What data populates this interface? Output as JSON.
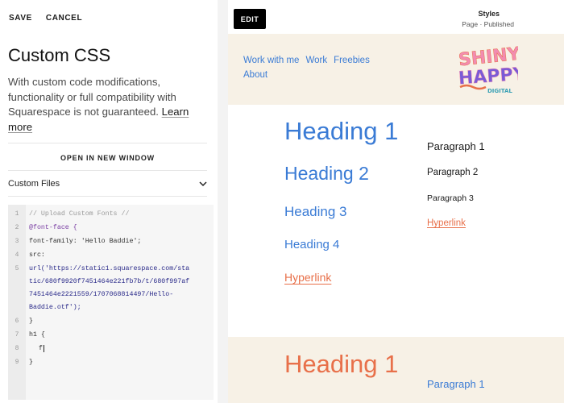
{
  "toolbar": {
    "save": "SAVE",
    "cancel": "CANCEL"
  },
  "panel": {
    "title": "Custom CSS",
    "description": "With custom code modifications, functionality or full compatibility with Squarespace is not guaranteed.",
    "learn_more": "Learn more",
    "open_new_window": "OPEN IN NEW WINDOW",
    "custom_files": "Custom Files"
  },
  "editor": {
    "line_numbers": [
      "1",
      "2",
      "3",
      "4",
      "5",
      "6",
      "7",
      "8"
    ],
    "lines": {
      "l1": "// Upload Custom Fonts //",
      "l2": "@font-face {",
      "l3": "font-family: 'Hello Baddie';",
      "l4": "src:",
      "l5a": "url('https://static1.squarespace.com/sta",
      "l5b": "tic/680f9920f7451464e221fb7b/t/680f997af",
      "l5c": "7451464e2221559/1707068814497/Hello-",
      "l5d": "Baddie.otf');",
      "l6": "}",
      "l7": "h1 {",
      "l8": "f",
      "l9": "}"
    }
  },
  "preview": {
    "edit": "EDIT",
    "styles_title": "Styles",
    "styles_sub": "Page · Published",
    "nav": [
      "Work with me",
      "Work",
      "Freebies",
      "About"
    ],
    "logo": {
      "line1": "SHINY",
      "line2": "HAPPY",
      "line3": "DIGITAL"
    },
    "section1": {
      "heading1": "Heading 1",
      "heading2": "Heading 2",
      "heading3": "Heading 3",
      "heading4": "Heading 4",
      "hyperlink": "Hyperlink",
      "paragraph1": "Paragraph 1",
      "paragraph2": "Paragraph 2",
      "paragraph3": "Paragraph 3",
      "hyperlink2": "Hyperlink"
    },
    "section2": {
      "heading1": "Heading 1",
      "paragraph1": "Paragraph 1"
    }
  },
  "colors": {
    "accent_blue": "#3a7bd5",
    "accent_orange": "#e8704a",
    "header_bg": "#f7f1e6"
  }
}
